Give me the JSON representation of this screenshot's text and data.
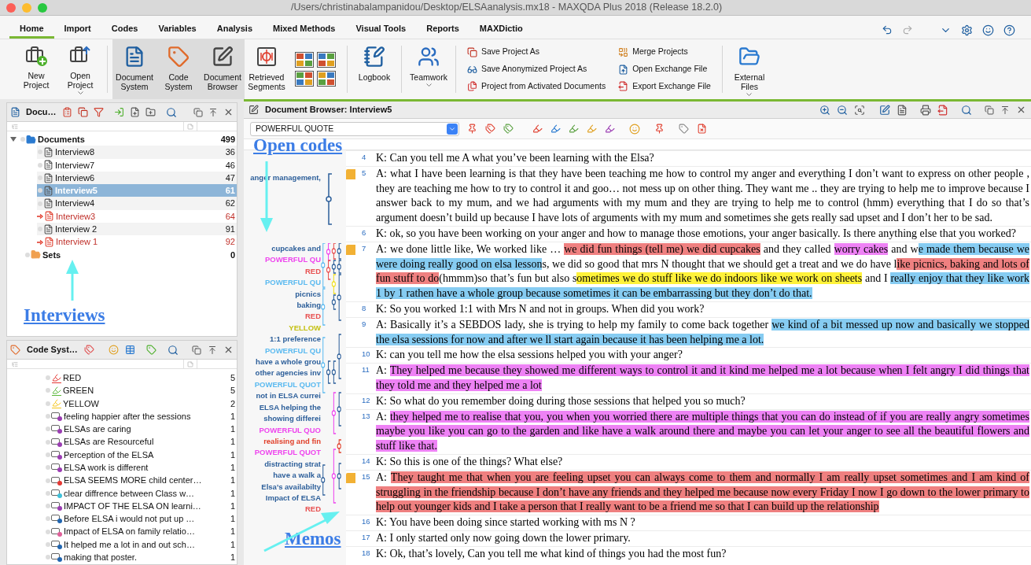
{
  "window": {
    "title": "/Users/christinabalampanidou/Desktop/ELSAanalysis.mx18 - MAXQDA Plus 2018 (Release 18.2.0)"
  },
  "ribbon_tabs": [
    {
      "label": "Home",
      "selected": true
    },
    {
      "label": "Import",
      "selected": false
    },
    {
      "label": "Codes",
      "selected": false
    },
    {
      "label": "Variables",
      "selected": false
    },
    {
      "label": "Analysis",
      "selected": false
    },
    {
      "label": "Mixed Methods",
      "selected": false
    },
    {
      "label": "Visual Tools",
      "selected": false
    },
    {
      "label": "Reports",
      "selected": false
    },
    {
      "label": "MAXDictio",
      "selected": false
    }
  ],
  "ribbon_items": [
    {
      "kind": "large",
      "label": "New Project",
      "selected": false,
      "dropdown": false
    },
    {
      "kind": "large",
      "label": "Open Project",
      "selected": false,
      "dropdown": true
    },
    {
      "kind": "separator"
    },
    {
      "kind": "large",
      "label": "Document System",
      "selected": true,
      "dropdown": false
    },
    {
      "kind": "large",
      "label": "Code System",
      "selected": true,
      "dropdown": false
    },
    {
      "kind": "large",
      "label": "Document Browser",
      "selected": true,
      "dropdown": false
    },
    {
      "kind": "large",
      "label": "Retrieved Segments",
      "selected": false,
      "dropdown": false
    },
    {
      "kind": "grid"
    },
    {
      "kind": "separator"
    },
    {
      "kind": "large",
      "label": "Logbook",
      "selected": false,
      "dropdown": false
    },
    {
      "kind": "separator"
    },
    {
      "kind": "large",
      "label": "Teamwork",
      "selected": false,
      "dropdown": true
    },
    {
      "kind": "separator"
    },
    {
      "kind": "list",
      "items": [
        {
          "label": "Save Project As"
        },
        {
          "label": "Save Anonymized Project As"
        },
        {
          "label": "Project from Activated Documents"
        }
      ]
    },
    {
      "kind": "list",
      "items": [
        {
          "label": "Merge Projects"
        },
        {
          "label": "Open Exchange File"
        },
        {
          "label": "Export Exchange File"
        }
      ]
    },
    {
      "kind": "separator"
    },
    {
      "kind": "large",
      "label": "External Files",
      "selected": false,
      "dropdown": true
    }
  ],
  "document_panel": {
    "title": "Docu…",
    "root": {
      "name": "Documents",
      "count": "499",
      "expanded": true,
      "children": [
        {
          "name": "Interview8",
          "count": "36",
          "selected": false,
          "activated": false
        },
        {
          "name": "Interview7",
          "count": "46",
          "selected": false,
          "activated": false
        },
        {
          "name": "Interview6",
          "count": "47",
          "selected": false,
          "activated": false
        },
        {
          "name": "Interview5",
          "count": "61",
          "selected": true,
          "activated": false
        },
        {
          "name": "Interview4",
          "count": "62",
          "selected": false,
          "activated": false
        },
        {
          "name": "Interview3",
          "count": "64",
          "selected": false,
          "activated": true
        },
        {
          "name": "Interview 2",
          "count": "91",
          "selected": false,
          "activated": false
        },
        {
          "name": "Interview 1",
          "count": "92",
          "selected": false,
          "activated": true
        }
      ]
    },
    "sets": {
      "name": "Sets",
      "count": "0"
    }
  },
  "code_panel": {
    "title": "Code Syst…",
    "codes": [
      {
        "kind": "marker",
        "name": "RED",
        "count": "5",
        "color": "#e53935"
      },
      {
        "kind": "marker",
        "name": "GREEN",
        "count": "5",
        "color": "#5cb83a"
      },
      {
        "kind": "marker",
        "name": "YELLOW",
        "count": "2",
        "color": "#f5c518"
      },
      {
        "kind": "code",
        "name": "feeling happier after the sessions",
        "count": "1",
        "color": "#9b3db3"
      },
      {
        "kind": "code",
        "name": "ELSAs are caring",
        "count": "1",
        "color": "#9b3db3"
      },
      {
        "kind": "code",
        "name": "ELSAs are Resourceful",
        "count": "1",
        "color": "#9b3db3"
      },
      {
        "kind": "code",
        "name": "Perception of the ELSA",
        "count": "1",
        "color": "#9b3db3"
      },
      {
        "kind": "code",
        "name": "ELSA work is different",
        "count": "1",
        "color": "#9b3db3"
      },
      {
        "kind": "code",
        "name": "ELSA SEEMS MORE child center…",
        "count": "1",
        "color": "#e53935"
      },
      {
        "kind": "code",
        "name": "clear diffrence between Class w…",
        "count": "1",
        "color": "#3fc1d9"
      },
      {
        "kind": "code",
        "name": "IMPACT OF THE ELSA ON learni…",
        "count": "1",
        "color": "#9b3db3"
      },
      {
        "kind": "code",
        "name": "Before ELSA i would not put up …",
        "count": "1",
        "color": "#2166b0"
      },
      {
        "kind": "code",
        "name": "Impact of ELSA on family relatio…",
        "count": "1",
        "color": "#e0609a"
      },
      {
        "kind": "code",
        "name": "It helped me a lot in and out sch…",
        "count": "1",
        "color": "#2166b0"
      },
      {
        "kind": "code",
        "name": "making that poster.",
        "count": "1",
        "color": "#2166b0"
      }
    ]
  },
  "browser": {
    "title": "Document Browser: Interview5",
    "code_dropdown": "POWERFUL QUOTE",
    "stripe_groups": [
      {
        "labels": [
          {
            "text": "anger management,",
            "color": "#2d5f9a"
          }
        ]
      },
      {
        "labels": [
          {
            "text": "cupcakes and",
            "color": "#2d5f9a"
          },
          {
            "text": "POWERFUL QU",
            "color": "#ee44ee"
          },
          {
            "text": "RED",
            "color": "#e85050"
          },
          {
            "text": "POWERFUL QU",
            "color": "#5bbaf0"
          },
          {
            "text": "picnics",
            "color": "#2d5f9a"
          },
          {
            "text": "baking",
            "color": "#2d5f9a"
          },
          {
            "text": "RED",
            "color": "#e85050"
          },
          {
            "text": "YELLOW",
            "color": "#c4c010"
          },
          {
            "text": "1:1 preference",
            "color": "#2d5f9a"
          },
          {
            "text": "POWERFUL QU",
            "color": "#5bbaf0"
          },
          {
            "text": "have a whole grou",
            "color": "#2d5f9a"
          },
          {
            "text": "other agencies inv",
            "color": "#2d5f9a"
          },
          {
            "text": "POWERFUL QUOT",
            "color": "#5bbaf0"
          },
          {
            "text": "not in ELSA currei",
            "color": "#2d5f9a"
          },
          {
            "text": "ELSA helping the",
            "color": "#2d5f9a"
          },
          {
            "text": "showing differei",
            "color": "#2d5f9a"
          },
          {
            "text": "POWERFUL QUO",
            "color": "#ee44ee"
          },
          {
            "text": "realising and fin",
            "color": "#e0402a"
          },
          {
            "text": "POWERFUL QUOT",
            "color": "#ee44ee"
          },
          {
            "text": "distracting strat",
            "color": "#2d5f9a"
          },
          {
            "text": "have a walk a",
            "color": "#2d5f9a"
          },
          {
            "text": "Elsa’s availabilty",
            "color": "#2d5f9a"
          },
          {
            "text": "Impact of ELSA",
            "color": "#2d5f9a"
          },
          {
            "text": "RED",
            "color": "#e85050"
          }
        ]
      }
    ],
    "paragraphs": [
      {
        "number": "4",
        "memo": false,
        "segments": [
          {
            "text": "K: Can you tell me A what you’ve been learning with the Elsa?"
          }
        ]
      },
      {
        "number": "5",
        "memo": true,
        "segments": [
          {
            "text": "A: what I have been learning is that they have been teaching me how to control my anger and everything I don’t want to express on other people , they are teaching me how to try to control it and goo… not mess up on other thing. They want me .. they are trying to help me to improve because I answer back to my mum, and we had arguments with my mum and they are trying to help me to control (hmm) everything that I do so that’s argument doesn’t build up because I have lots of arguments with my mum and sometimes she gets really sad upset and I don’t her to be sad."
          }
        ]
      },
      {
        "number": "6",
        "memo": false,
        "segments": [
          {
            "text": "K: ok, so you have been working on your anger and how to manage those emotions, your anger basically. Is there anything else that you worked?"
          }
        ]
      },
      {
        "number": "7",
        "memo": true,
        "segments": [
          {
            "text": "A: we done little like, We worked like … "
          },
          {
            "text": "we did fun things (tell me) we did cupcakes",
            "color": "#ef8080"
          },
          {
            "text": " and they called "
          },
          {
            "text": "worry cakes",
            "color": "#ee82f5"
          },
          {
            "text": " and w"
          },
          {
            "text": "e made them because we were doing really good on elsa lesson",
            "color": "#86ccf2"
          },
          {
            "text": "s, we did so good that mrs N thought that we should get a treat and we do have l"
          },
          {
            "text": "ike picnics, baking and lots of fun stuff to do",
            "color": "#ef8080"
          },
          {
            "text": "(hmmm)so that’s fun but also s"
          },
          {
            "text": "ometimes we do stuff like we do indoors like we work on sheets",
            "color": "#fff23a"
          },
          {
            "text": " and I "
          },
          {
            "text": "really enjoy that they like work 1 by 1 rathen have a whole group because sometimes it can be embarrassing but they don’t do that.",
            "color": "#86ccf2"
          }
        ]
      },
      {
        "number": "8",
        "memo": false,
        "segments": [
          {
            "text": "K: So you worked 1:1 with Mrs N and not in groups. When did you work?"
          }
        ]
      },
      {
        "number": "9",
        "memo": false,
        "segments": [
          {
            "text": "A: Basically it’s a SEBDOS lady, she is trying to help my family to come back together "
          },
          {
            "text": "we kind of a bit messed up now and basically we stopped the elsa sessions for now and after we ll start again because it has been helping me a lot.",
            "color": "#86ccf2"
          }
        ]
      },
      {
        "number": "10",
        "memo": false,
        "segments": [
          {
            "text": "K: can you tell me how the elsa sessions helped you with your anger?"
          }
        ]
      },
      {
        "number": "11",
        "memo": false,
        "segments": [
          {
            "text": "A: "
          },
          {
            "text": "They helped me because they showed me different ways to control it and it kind me helped me a lot because when I felt angry I did things that they told me and they helped me a lot",
            "color": "#ee82f5"
          }
        ]
      },
      {
        "number": "12",
        "memo": false,
        "segments": [
          {
            "text": "K: So what do you remember doing during those sessions that helped you so much?"
          }
        ]
      },
      {
        "number": "13",
        "memo": false,
        "segments": [
          {
            "text": "A: "
          },
          {
            "text": "they helped me to realise that you, you when you worried there are multiple things that you can do instead of if you are really angry sometimes maybe you like you can go to the garden and like have a walk around there and maybe you can let your anger to see all the beautiful flowers and stuff like that.",
            "color": "#ee82f5"
          }
        ]
      },
      {
        "number": "14",
        "memo": false,
        "segments": [
          {
            "text": "K: So this is one of the things? What else?"
          }
        ]
      },
      {
        "number": "15",
        "memo": true,
        "segments": [
          {
            "text": "A: "
          },
          {
            "text": "They taught me that when you are feeling upset you can always come to them and normally I am really upset sometimes and I am kind of struggling in the friendship because I don’t have any friends and they helped me because now every Friday I now I go down to the lower primary to help out younger kids and I take a person that I really want to be a friend me so that I can build up the relationship",
            "color": "#ef8080"
          }
        ]
      },
      {
        "number": "16",
        "memo": false,
        "segments": [
          {
            "text": "K: You have been doing since started working with ms N ?"
          }
        ]
      },
      {
        "number": "17",
        "memo": false,
        "segments": [
          {
            "text": "A: I only started only now going down the lower primary."
          }
        ]
      },
      {
        "number": "18",
        "memo": false,
        "segments": [
          {
            "text": "K: Ok, that’s lovely, Can you tell me what kind of things you had the most fun?"
          }
        ]
      }
    ]
  },
  "annotations": [
    {
      "text": "Open codes"
    },
    {
      "text": "Interviews"
    },
    {
      "text": "Memos"
    }
  ]
}
